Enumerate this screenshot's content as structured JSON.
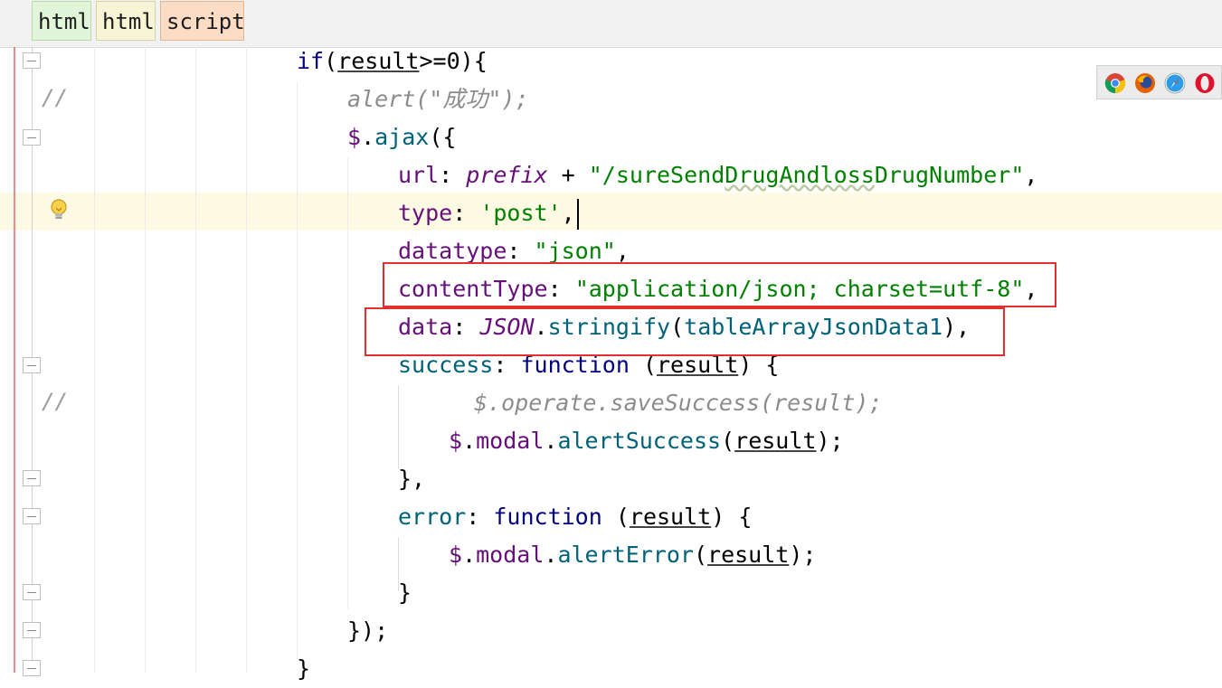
{
  "breadcrumbs": [
    {
      "label": "html"
    },
    {
      "label": "html"
    },
    {
      "label": "script"
    }
  ],
  "gutter": {
    "comment_marker": "//"
  },
  "browser_icons": [
    "chrome-icon",
    "firefox-icon",
    "safari-icon",
    "opera-icon"
  ],
  "code": {
    "l1": {
      "kw": "if",
      "open": "(",
      "var": "result",
      "rest": ">=0){"
    },
    "l2": {
      "comment": "alert(\"成功\");"
    },
    "l3": {
      "dollar": "$",
      "dot": ".",
      "method": "ajax",
      "rest": "({"
    },
    "l4": {
      "key": "url",
      "colon": ": ",
      "var": "prefix",
      "plus": " + ",
      "str_open": "\"/sureSend",
      "str_mid": "DrugAndloss",
      "str_close": "DrugNumber\"",
      "comma": ","
    },
    "l5": {
      "key": "type",
      "colon": ": ",
      "str": "'post'",
      "comma": ","
    },
    "l6": {
      "key": "datatype",
      "colon": ": ",
      "str": "\"json\"",
      "comma": ","
    },
    "l7": {
      "key": "contentType",
      "colon": ": ",
      "str": "\"application/json; charset=utf-8\"",
      "comma": ","
    },
    "l8": {
      "key": "data",
      "colon": ": ",
      "obj": "JSON",
      "dot": ".",
      "method": "stringify",
      "open": "(",
      "arg": "tableArrayJsonData1",
      "close": "),"
    },
    "l9": {
      "key": "success",
      "colon": ": ",
      "kw": "function",
      "open": " (",
      "param": "result",
      "close": ") {"
    },
    "l10": {
      "comment": "$.operate.saveSuccess(result);"
    },
    "l11": {
      "dollar": "$",
      "dot": ".",
      "prop": "modal",
      "dot2": ".",
      "method": "alertSuccess",
      "open": "(",
      "param": "result",
      "close": ");"
    },
    "l12": {
      "text": "},"
    },
    "l13": {
      "key": "error",
      "colon": ": ",
      "kw": "function",
      "open": " (",
      "param": "result",
      "close": ") {"
    },
    "l14": {
      "dollar": "$",
      "dot": ".",
      "prop": "modal",
      "dot2": ".",
      "method": "alertError",
      "open": "(",
      "param": "result",
      "close": ");"
    },
    "l15": {
      "text": "}"
    },
    "l16": {
      "text": "});"
    },
    "l17": {
      "text": "}"
    }
  },
  "colors": {
    "keyword": "#000080",
    "property": "#660e7a",
    "string": "#008000",
    "function_call": "#00627a",
    "comment": "#8c8c8c",
    "highlight_box": "#e03030",
    "caret_line": "#fffae3"
  }
}
